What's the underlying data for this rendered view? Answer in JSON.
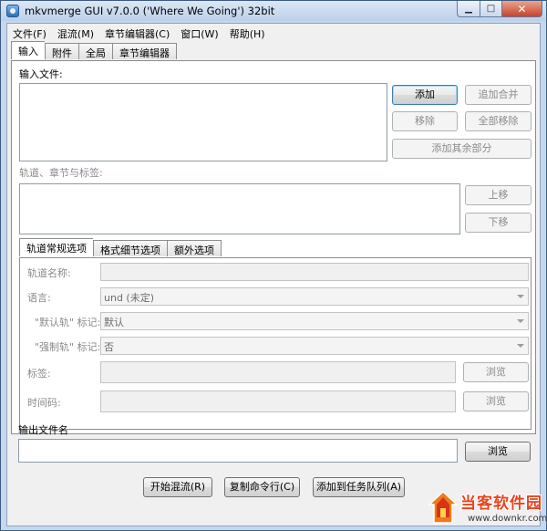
{
  "window": {
    "title": "mkvmerge GUI v7.0.0 ('Where We Going') 32bit",
    "minimize_glyph": "▁",
    "maximize_glyph": "□",
    "close_glyph": "✕"
  },
  "menu": [
    "文件(F)",
    "混流(M)",
    "章节编辑器(C)",
    "窗口(W)",
    "帮助(H)"
  ],
  "main_tabs": [
    {
      "label": "输入",
      "active": true
    },
    {
      "label": "附件",
      "active": false
    },
    {
      "label": "全局",
      "active": false
    },
    {
      "label": "章节编辑器",
      "active": false
    }
  ],
  "input": {
    "input_files_label": "输入文件:",
    "buttons": {
      "add": "添加",
      "append": "追加合并",
      "remove": "移除",
      "remove_all": "全部移除",
      "add_parts": "添加其余部分"
    },
    "tracks_label": "轨道、章节与标签:",
    "move_up": "上移",
    "move_down": "下移"
  },
  "track_tabs": [
    {
      "label": "轨道常规选项",
      "active": true
    },
    {
      "label": "格式细节选项",
      "active": false
    },
    {
      "label": "额外选项",
      "active": false
    }
  ],
  "track_options": {
    "track_name_label": "轨道名称:",
    "language_label": "语言:",
    "language_value": "und (未定)",
    "default_track_label": "\"默认轨\" 标记:",
    "default_track_value": "默认",
    "forced_track_label": "\"强制轨\" 标记:",
    "forced_track_value": "否",
    "tags_label": "标签:",
    "timecodes_label": "时间码:",
    "browse": "浏览"
  },
  "output": {
    "label": "输出文件名",
    "browse": "浏览"
  },
  "actions": {
    "start_muxing": "开始混流(R)",
    "copy_command": "复制命令行(C)",
    "add_to_queue": "添加到任务队列(A)"
  },
  "watermark": {
    "name": "当客软件园",
    "url": "www.downkr.com"
  },
  "colors": {
    "accent": "#3c7fb1",
    "watermark": "#e8441c"
  }
}
